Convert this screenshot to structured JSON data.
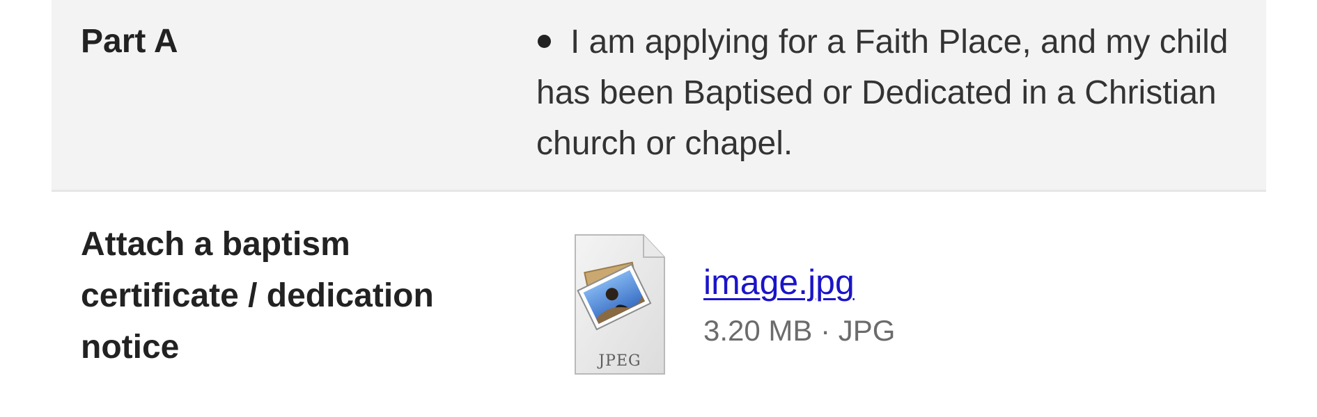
{
  "rows": [
    {
      "label": "Part A",
      "items": [
        "I am applying for a Faith Place, and my child has been Baptised or Dedicated in a Christian church or chapel."
      ]
    },
    {
      "label": "Attach a baptism certificate / dedication notice",
      "attachment": {
        "file_name": "image.jpg",
        "file_info": "3.20 MB · JPG",
        "icon_label": "JPEG",
        "icon": "jpeg-file-icon"
      }
    }
  ],
  "colors": {
    "row_shaded_bg": "#f3f3f3",
    "divider": "#e6e6e6",
    "link": "#1a14c8",
    "label_text": "#222222",
    "secondary_text": "#6b6b6b"
  }
}
